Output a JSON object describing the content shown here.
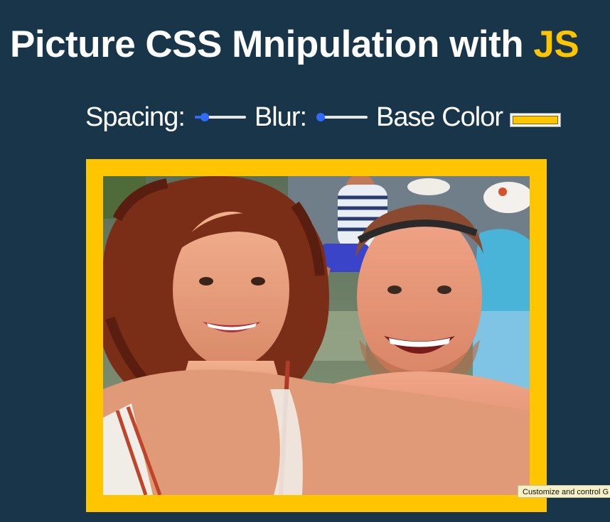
{
  "header": {
    "title_main": "Picture CSS Mnipulation with ",
    "title_highlight": "JS"
  },
  "controls": {
    "spacing_label": "Spacing:",
    "spacing_value": 0.2,
    "blur_label": "Blur:",
    "blur_value": 0.0,
    "base_color_label": "Base Color",
    "base_color_value": "#ffc600"
  },
  "colors": {
    "background": "#193549",
    "accent": "#ffc600",
    "slider_accent": "#2f6bff"
  },
  "photo": {
    "subject": "selfie-photo"
  },
  "tooltip": {
    "text": "Customize and control G"
  }
}
